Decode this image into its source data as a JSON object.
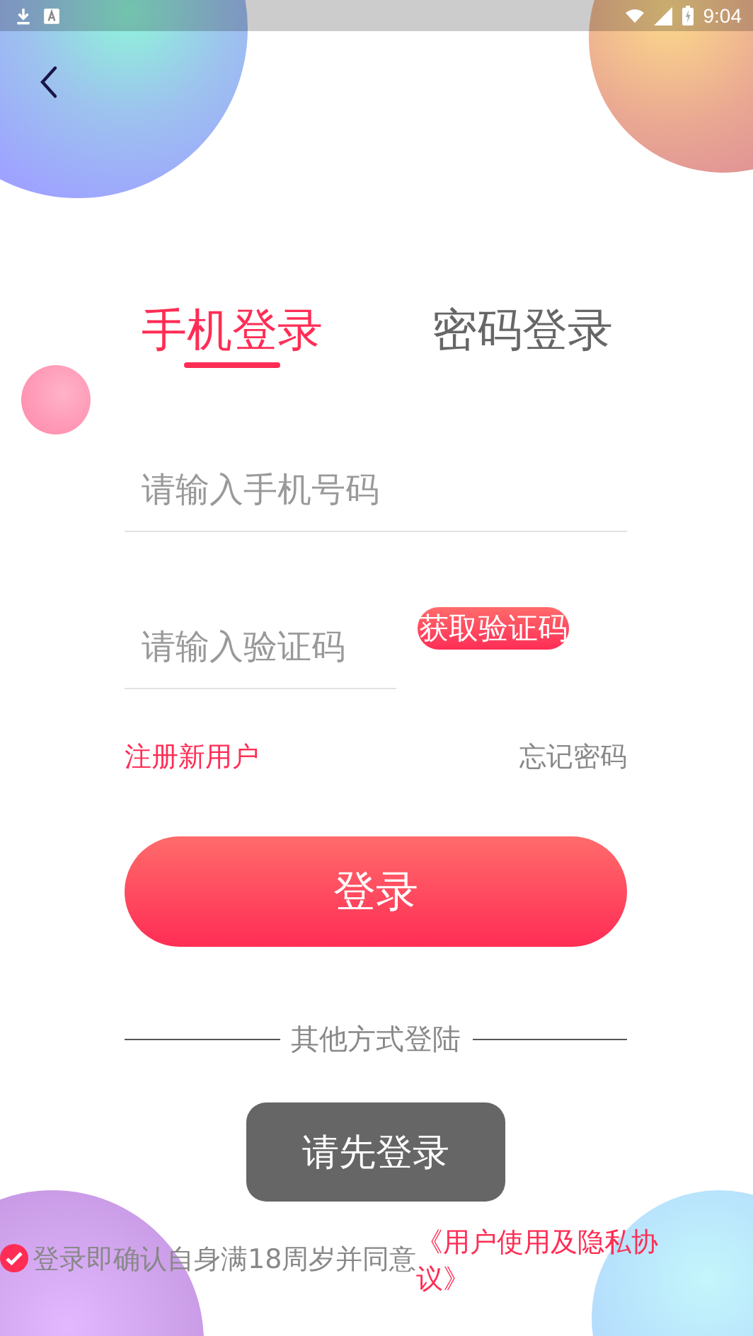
{
  "status_bar": {
    "time": "9:04"
  },
  "tabs": [
    {
      "label": "手机登录",
      "selected": true
    },
    {
      "label": "密码登录",
      "selected": false
    }
  ],
  "phone_field": {
    "placeholder": "请输入手机号码"
  },
  "code_field": {
    "placeholder": "请输入验证码"
  },
  "get_code_button": "获取验证码",
  "links": [
    {
      "label": "注册新用户",
      "kind": "register"
    },
    {
      "label": "忘记密码",
      "kind": "forgot"
    }
  ],
  "login_button": "登录",
  "other_login_label": "其他方式登陆",
  "toast": "请先登录",
  "agreement": {
    "checked": true,
    "text": "登录即确认自身满18周岁并同意",
    "link": "《用户使用及隐私协议》"
  }
}
